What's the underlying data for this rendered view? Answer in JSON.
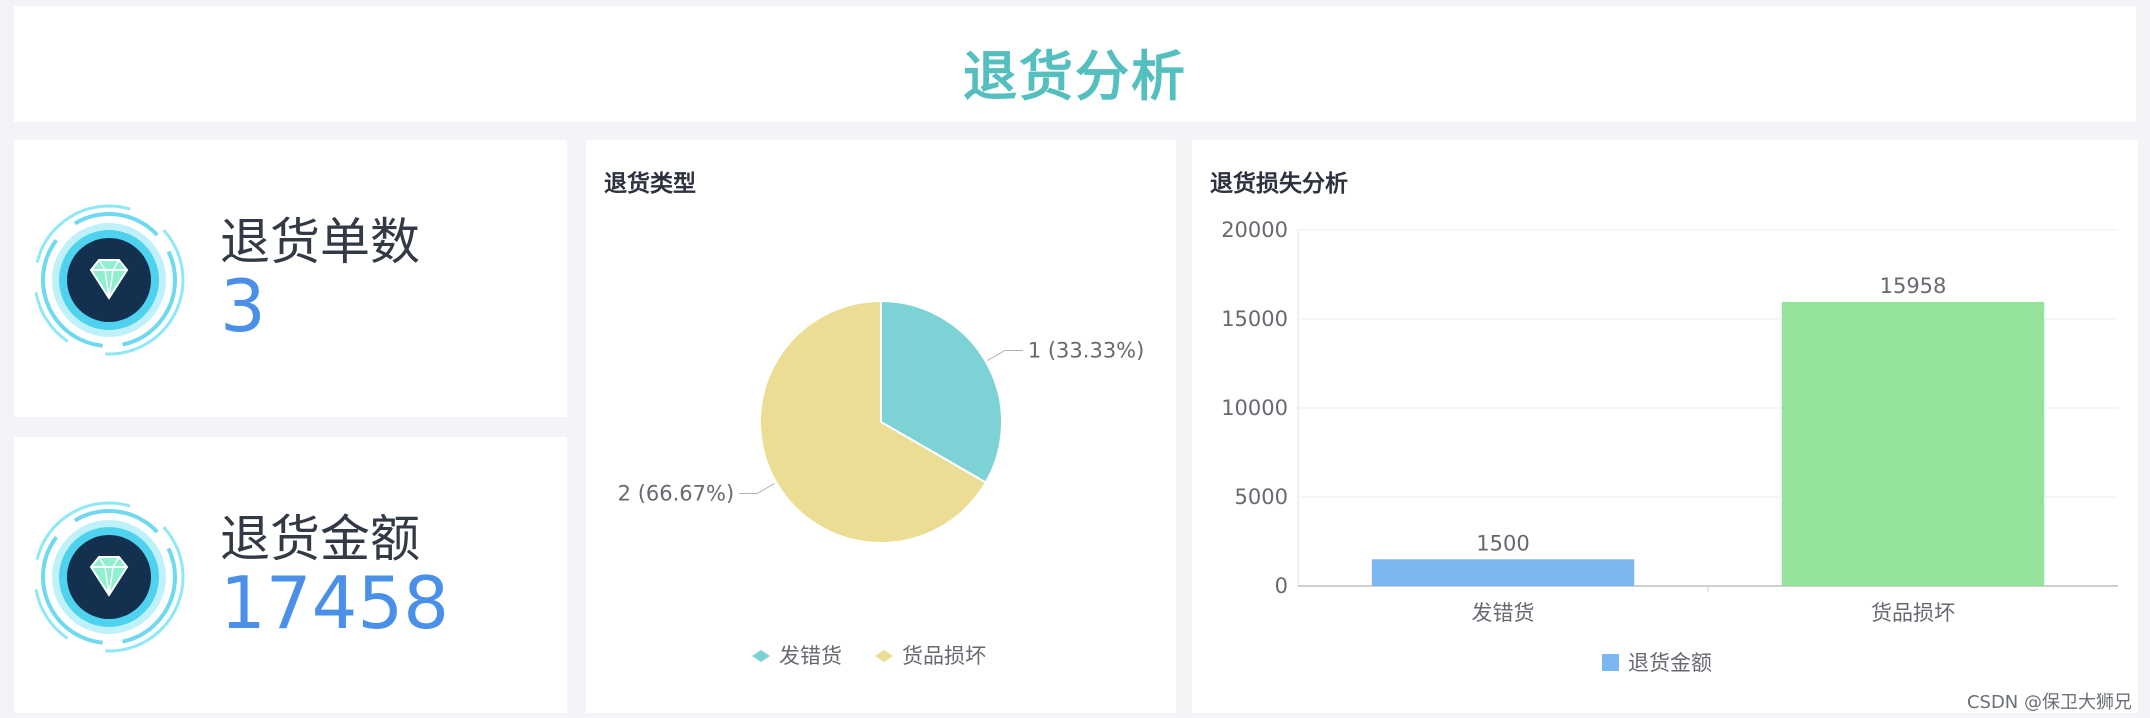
{
  "header": {
    "title": "退货分析"
  },
  "kpis": {
    "count": {
      "label": "退货单数",
      "value": "3",
      "icon": "diamond-icon"
    },
    "amount": {
      "label": "退货金额",
      "value": "17458",
      "icon": "diamond-icon"
    }
  },
  "pie": {
    "title": "退货类型",
    "legend": [
      "发错货",
      "货品损坏"
    ]
  },
  "bar": {
    "title": "退货损失分析",
    "legend": "退货金额"
  },
  "colors": {
    "title": "#55bfbf",
    "kpi_value": "#4a8fe8",
    "pie_1": "#7dd2d6",
    "pie_2": "#ecdd94",
    "bar_1": "#7bb7f0",
    "bar_2": "#95e39a"
  },
  "chart_data": [
    {
      "type": "pie",
      "title": "退货类型",
      "slices": [
        {
          "name": "发错货",
          "value": 1,
          "label": "1 (33.33%)"
        },
        {
          "name": "货品损坏",
          "value": 2,
          "label": "2 (66.67%)"
        }
      ]
    },
    {
      "type": "bar",
      "title": "退货损失分析",
      "categories": [
        "发错货",
        "货品损坏"
      ],
      "series": [
        {
          "name": "退货金额",
          "values": [
            1500,
            15958
          ]
        }
      ],
      "ylim": [
        0,
        20000
      ],
      "yticks": [
        0,
        5000,
        10000,
        15000,
        20000
      ],
      "grid": true,
      "legend": "bottom-center"
    }
  ],
  "watermark": "CSDN @保卫大狮兄"
}
